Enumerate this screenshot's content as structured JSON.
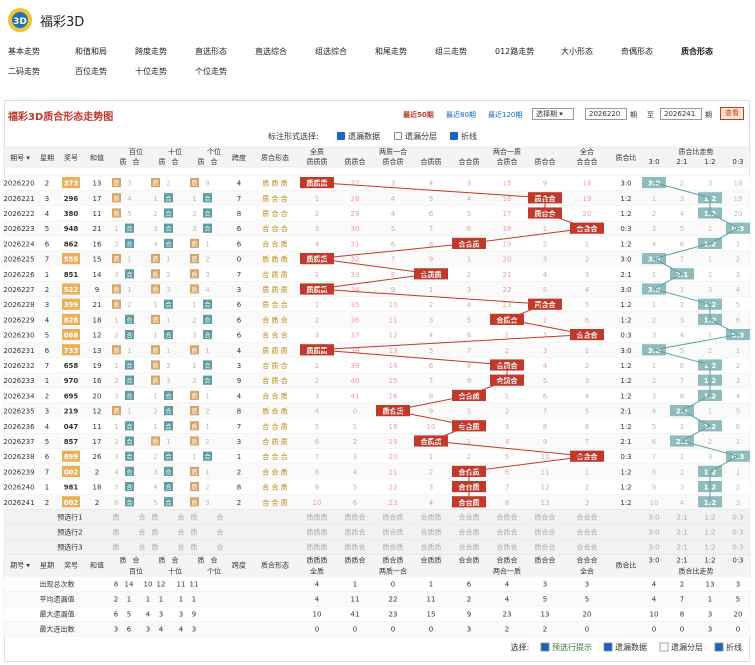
{
  "app": {
    "title": "福彩3D"
  },
  "nav": {
    "items": [
      "基本走势",
      "和值和局",
      "跨度走势",
      "直选形态",
      "直选综合",
      "组选综合",
      "和尾走势",
      "组三走势",
      "012路走势",
      "大小形态",
      "奇偶形态",
      "质合形态",
      "二码走势",
      "百位走势",
      "十位走势",
      "个位走势"
    ]
  },
  "page": {
    "title": "福彩3D质合形态走势图",
    "recent50": "最近50期",
    "recent80": "最近80期",
    "recent120": "最近120期",
    "select_label": "选择期 ▾",
    "from": "2026220",
    "period1": "期",
    "to_label": "至",
    "to": "2026241",
    "period2": "期",
    "query": "查看"
  },
  "options": {
    "label": "标注形式选择:",
    "missing": "遗漏数据",
    "layer": "遗漏分层",
    "line": "折线"
  },
  "colors": {
    "accent": "#c0392b",
    "ball": "#e8b05a",
    "teal": "#8fbcbb",
    "zong": "#e67e22"
  },
  "headers": {
    "qihao": "期号 ▾",
    "xingqi": "星期",
    "jianghao": "奖号",
    "hezhi": "和值",
    "bai": "百位",
    "shi": "十位",
    "ge": "个位",
    "zhi": "质",
    "he": "合",
    "kuadu": "跨度",
    "form": "质合形态",
    "quanzhi": "全质",
    "quanzhi_sub": "质质质",
    "liangzhi": "两质一合",
    "lz1": "质质合",
    "lz2": "质合质",
    "lz3": "合质质",
    "lianghe": "两合一质",
    "lh1": "合合质",
    "lh2": "合质合",
    "lh3": "质合合",
    "quanhe": "全合",
    "quanhe_sub": "合合合",
    "ratio": "质合比",
    "ratio_trend": "质合比走势",
    "r1": "3:0",
    "r2": "2:1",
    "r3": "1:2",
    "r4": "0:3"
  },
  "rows": [
    {
      "q": "2026220",
      "w": "2",
      "n": "373",
      "s": "13",
      "b": "质",
      "bc": "3",
      "bz": "质",
      "sc": "2",
      "g": "质",
      "gc": "9",
      "k": "4",
      "f": "质质质",
      "m": [
        0,
        27,
        3,
        4,
        3,
        15,
        9,
        18
      ],
      "r": "3:0",
      "mr": [
        0,
        2,
        3,
        18
      ],
      "c": 0,
      "ri": 0
    },
    {
      "q": "2026221",
      "w": "3",
      "n": "296",
      "s": "17",
      "b": "质",
      "bc": "4",
      "sz": "合",
      "sc": "1",
      "g": "合",
      "gc": "1",
      "k": "7",
      "f": "质合合",
      "m": [
        1,
        28,
        4,
        5,
        4,
        16,
        0,
        19
      ],
      "r": "1:2",
      "mr": [
        1,
        3,
        0,
        19
      ],
      "c": 6,
      "ri": 2
    },
    {
      "q": "2026222",
      "w": "4",
      "n": "380",
      "s": "11",
      "b": "质",
      "bc": "5",
      "sz": "合",
      "sc": "2",
      "g": "合",
      "gc": "2",
      "k": "8",
      "f": "质合合",
      "m": [
        2,
        29,
        4,
        6,
        5,
        17,
        0,
        20
      ],
      "r": "1:2",
      "mr": [
        2,
        4,
        0,
        20
      ],
      "c": 6,
      "ri": 2
    },
    {
      "q": "2026223",
      "w": "5",
      "n": "948",
      "s": "21",
      "b": "合",
      "bc": "1",
      "sz": "合",
      "sc": "3",
      "g": "合",
      "gc": "3",
      "k": "6",
      "f": "合合合",
      "m": [
        3,
        30,
        5,
        7,
        6,
        18,
        1,
        0
      ],
      "r": "0:3",
      "mr": [
        3,
        5,
        1,
        0
      ],
      "c": 7,
      "ri": 3
    },
    {
      "q": "2026224",
      "w": "6",
      "n": "862",
      "s": "16",
      "b": "合",
      "bc": "2",
      "sz": "合",
      "sc": "4",
      "g": "质",
      "gc": "1",
      "k": "6",
      "f": "合合质",
      "m": [
        4,
        31,
        6,
        8,
        0,
        19,
        2,
        1
      ],
      "r": "1:2",
      "mr": [
        4,
        6,
        0,
        1
      ],
      "c": 4,
      "ri": 2
    },
    {
      "q": "2026225",
      "w": "7",
      "n": "555",
      "s": "15",
      "b": "质",
      "bc": "1",
      "bz": "质",
      "sc": "1",
      "g": "质",
      "gc": "2",
      "k": "0",
      "f": "质质质",
      "m": [
        0,
        32,
        7,
        9,
        1,
        20,
        3,
        2
      ],
      "r": "3:0",
      "mr": [
        0,
        7,
        1,
        2
      ],
      "c": 0,
      "ri": 0
    },
    {
      "q": "2026226",
      "w": "1",
      "n": "851",
      "s": "14",
      "b": "合",
      "bc": "3",
      "bz": "质",
      "sc": "2",
      "g": "质",
      "gc": "3",
      "k": "7",
      "f": "合质质",
      "m": [
        1,
        33,
        8,
        0,
        2,
        21,
        4,
        3
      ],
      "r": "2:1",
      "mr": [
        1,
        0,
        2,
        3
      ],
      "c": 3,
      "ri": 1
    },
    {
      "q": "2026227",
      "w": "2",
      "n": "522",
      "s": "9",
      "b": "质",
      "bc": "1",
      "bz": "质",
      "sc": "3",
      "g": "质",
      "gc": "4",
      "k": "3",
      "f": "质质质",
      "m": [
        0,
        34,
        9,
        1,
        3,
        22,
        5,
        4
      ],
      "r": "3:0",
      "mr": [
        0,
        1,
        3,
        4
      ],
      "c": 0,
      "ri": 0
    },
    {
      "q": "2026228",
      "w": "3",
      "n": "399",
      "s": "21",
      "b": "质",
      "bc": "2",
      "sz": "合",
      "sc": "1",
      "g": "合",
      "gc": "1",
      "k": "6",
      "f": "质合合",
      "m": [
        1,
        35,
        10,
        2,
        4,
        23,
        0,
        5
      ],
      "r": "1:2",
      "mr": [
        1,
        2,
        0,
        5
      ],
      "c": 6,
      "ri": 2
    },
    {
      "q": "2026229",
      "w": "4",
      "n": "828",
      "s": "18",
      "b": "合",
      "bc": "1",
      "bz": "质",
      "sc": "1",
      "g": "合",
      "gc": "2",
      "k": "6",
      "f": "合质合",
      "m": [
        2,
        36,
        11,
        3,
        5,
        0,
        1,
        6
      ],
      "r": "1:2",
      "mr": [
        2,
        3,
        0,
        6
      ],
      "c": 5,
      "ri": 2
    },
    {
      "q": "2026230",
      "w": "5",
      "n": "066",
      "s": "12",
      "b": "合",
      "bc": "2",
      "sz": "合",
      "sc": "1",
      "g": "合",
      "gc": "3",
      "k": "6",
      "f": "合合合",
      "m": [
        3,
        37,
        12,
        4,
        6,
        1,
        2,
        0
      ],
      "r": "0:3",
      "mr": [
        3,
        4,
        1,
        0
      ],
      "c": 7,
      "ri": 3
    },
    {
      "q": "2026231",
      "w": "6",
      "n": "733",
      "s": "13",
      "b": "质",
      "bc": "1",
      "bz": "质",
      "sc": "1",
      "g": "质",
      "gc": "1",
      "k": "4",
      "f": "质质质",
      "m": [
        0,
        38,
        13,
        5,
        7,
        2,
        3,
        1
      ],
      "r": "3:0",
      "mr": [
        0,
        5,
        2,
        1
      ],
      "c": 0,
      "ri": 0
    },
    {
      "q": "2026232",
      "w": "7",
      "n": "658",
      "s": "19",
      "b": "合",
      "bc": "1",
      "bz": "质",
      "sc": "2",
      "g": "合",
      "gc": "1",
      "k": "3",
      "f": "合质合",
      "m": [
        1,
        39,
        14,
        6,
        8,
        0,
        4,
        2
      ],
      "r": "1:2",
      "mr": [
        1,
        6,
        0,
        2
      ],
      "c": 5,
      "ri": 2
    },
    {
      "q": "2026233",
      "w": "1",
      "n": "970",
      "s": "16",
      "b": "合",
      "bc": "2",
      "bz": "质",
      "sc": "3",
      "g": "合",
      "gc": "2",
      "k": "9",
      "f": "合质合",
      "m": [
        2,
        40,
        15,
        7,
        9,
        0,
        5,
        3
      ],
      "r": "1:2",
      "mr": [
        2,
        7,
        0,
        3
      ],
      "c": 5,
      "ri": 2
    },
    {
      "q": "2026234",
      "w": "2",
      "n": "695",
      "s": "20",
      "b": "合",
      "bc": "3",
      "sz": "合",
      "sc": "1",
      "g": "质",
      "gc": "1",
      "k": "4",
      "f": "合合质",
      "m": [
        3,
        41,
        16,
        8,
        0,
        1,
        6,
        4
      ],
      "r": "1:2",
      "mr": [
        3,
        8,
        0,
        4
      ],
      "c": 4,
      "ri": 2
    },
    {
      "q": "2026235",
      "w": "3",
      "n": "219",
      "s": "12",
      "b": "质",
      "bc": "1",
      "sz": "合",
      "sc": "2",
      "g": "质",
      "gc": "2",
      "k": "8",
      "f": "质合质",
      "m": [
        4,
        0,
        17,
        9,
        1,
        2,
        7,
        5
      ],
      "r": "2:1",
      "mr": [
        4,
        0,
        1,
        5
      ],
      "c": 2,
      "ri": 1
    },
    {
      "q": "2026236",
      "w": "4",
      "n": "047",
      "s": "11",
      "b": "合",
      "bc": "1",
      "sz": "合",
      "sc": "1",
      "g": "质",
      "gc": "1",
      "k": "7",
      "f": "合合质",
      "m": [
        5,
        1,
        18,
        10,
        0,
        3,
        8,
        6
      ],
      "r": "1:2",
      "mr": [
        5,
        1,
        0,
        6
      ],
      "c": 4,
      "ri": 2
    },
    {
      "q": "2026237",
      "w": "5",
      "n": "857",
      "s": "17",
      "b": "合",
      "bc": "2",
      "bz": "质",
      "sc": "1",
      "g": "质",
      "gc": "2",
      "k": "3",
      "f": "合质质",
      "m": [
        6,
        2,
        19,
        0,
        1,
        4,
        9,
        7
      ],
      "r": "2:1",
      "mr": [
        6,
        0,
        2,
        1
      ],
      "c": 3,
      "ri": 1
    },
    {
      "q": "2026238",
      "w": "6",
      "n": "899",
      "s": "26",
      "b": "合",
      "bc": "3",
      "sz": "合",
      "sc": "2",
      "g": "合",
      "gc": "1",
      "k": "1",
      "f": "合合合",
      "m": [
        7,
        3,
        20,
        1,
        2,
        5,
        10,
        0
      ],
      "r": "0:3",
      "mr": [
        7,
        1,
        3,
        0
      ],
      "c": 7,
      "ri": 3
    },
    {
      "q": "2026239",
      "w": "7",
      "n": "002",
      "s": "2",
      "b": "合",
      "bc": "4",
      "sz": "合",
      "sc": "3",
      "g": "质",
      "gc": "1",
      "k": "2",
      "f": "合合质",
      "m": [
        8,
        4,
        21,
        2,
        0,
        6,
        11,
        1
      ],
      "r": "1:2",
      "mr": [
        8,
        2,
        0,
        1
      ],
      "c": 4,
      "ri": 2
    },
    {
      "q": "2026240",
      "w": "1",
      "n": "981",
      "s": "18",
      "b": "合",
      "bc": "5",
      "sz": "合",
      "sc": "4",
      "g": "质",
      "gc": "2",
      "k": "8",
      "f": "合合质",
      "m": [
        9,
        5,
        22,
        3,
        0,
        7,
        12,
        2
      ],
      "r": "1:2",
      "mr": [
        9,
        3,
        0,
        2
      ],
      "c": 4,
      "ri": 2
    },
    {
      "q": "2026241",
      "w": "2",
      "n": "002",
      "s": "2",
      "b": "合",
      "bc": "6",
      "sz": "合",
      "sc": "5",
      "g": "质",
      "gc": "3",
      "k": "2",
      "f": "合合质",
      "m": [
        10,
        6,
        23,
        4,
        0,
        8,
        13,
        3
      ],
      "r": "1:2",
      "mr": [
        10,
        4,
        0,
        3
      ],
      "c": 4,
      "ri": 2
    }
  ],
  "predict": {
    "labels": [
      "预选行1",
      "预选行2",
      "预选行3"
    ],
    "zh": [
      "质",
      "合",
      "质",
      "合",
      "质",
      "合"
    ],
    "forms": [
      "质质质",
      "质质合",
      "质合质",
      "合质质",
      "合合质",
      "合质合",
      "质合合",
      "合合合"
    ],
    "ratios": [
      "3:0",
      "2:1",
      "1:2",
      "0:3"
    ]
  },
  "stats": {
    "sub_bai": "百位",
    "sub_shi": "十位",
    "sub_ge": "个位",
    "rows": [
      {
        "label": "出现总次数",
        "zh": [
          "8",
          "14",
          "10",
          "12",
          "11",
          "11"
        ],
        "m": [
          "4",
          "1",
          "0",
          "1",
          "6",
          "4",
          "3",
          "3"
        ],
        "r": [
          "4",
          "2",
          "13",
          "3"
        ]
      },
      {
        "label": "平均遗漏值",
        "zh": [
          "2",
          "1",
          "1",
          "1",
          "1",
          "1"
        ],
        "m": [
          "4",
          "11",
          "22",
          "11",
          "2",
          "4",
          "5",
          "5"
        ],
        "r": [
          "4",
          "7",
          "1",
          "5"
        ]
      },
      {
        "label": "最大遗漏值",
        "zh": [
          "6",
          "5",
          "4",
          "3",
          "3",
          "9"
        ],
        "m": [
          "10",
          "41",
          "23",
          "15",
          "9",
          "23",
          "13",
          "20"
        ],
        "r": [
          "10",
          "8",
          "3",
          "20"
        ]
      },
      {
        "label": "最大连出数",
        "zh": [
          "3",
          "6",
          "3",
          "4",
          "4",
          "3"
        ],
        "m": [
          "0",
          "0",
          "0",
          "0",
          "3",
          "2",
          "2",
          "0"
        ],
        "r": [
          "0",
          "0",
          "3",
          "0"
        ]
      }
    ]
  },
  "footer": {
    "label": "选择:",
    "tip": "预选行提示",
    "missing": "遗漏数据",
    "layer": "遗漏分层",
    "line": "折线"
  }
}
